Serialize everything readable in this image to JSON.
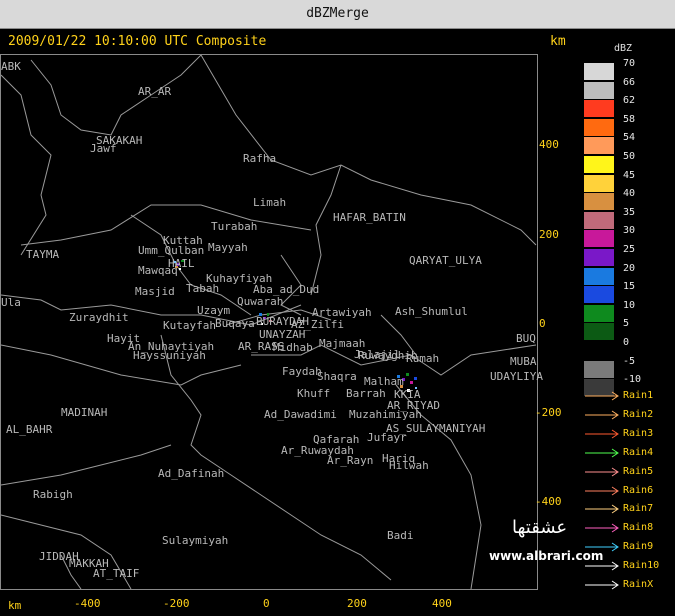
{
  "window": {
    "title": "dBZMerge"
  },
  "header": {
    "datetime": "2009/01/22 10:10:00 UTC Composite",
    "unit": "km"
  },
  "x_axis": {
    "unit": "km",
    "ticks": [
      "-400",
      "-200",
      "0",
      "200",
      "400"
    ]
  },
  "y_axis": {
    "ticks": [
      "400",
      "200",
      "0",
      "-200",
      "-400"
    ]
  },
  "places": [
    "ABK",
    "AR_AR",
    "SAKAKAH",
    "Jawf",
    "Rafha",
    "Limah",
    "HAFAR_BATIN",
    "Turabah",
    "Kuttah",
    "Mayyah",
    "Umm_Qulban",
    "TAYMA",
    "Mawqaq",
    "HAIL",
    "Kuhayfiyah",
    "QARYAT_ULYA",
    "Tabah",
    "Aba_ad_Dud",
    "Masjid",
    "Quwarah",
    "Ula",
    "Uzaym",
    "Artawiyah",
    "Ash_Shumlul",
    "Zuraydhit",
    "Kutayfah",
    "Buqaya",
    "BURAYDAH",
    "AZ_Zilfi",
    "BUQ",
    "Hayit",
    "UNAYZAH",
    "An_Nuhaytiyah",
    "AR_RASS",
    "Midhab",
    "Majmaah",
    "Hayssuniyah",
    "Jalajil",
    "Ruwayghib",
    "Rumah",
    "MUBA",
    "UDAYLIYA",
    "Faydah",
    "Shaqra",
    "Malham",
    "Khuff",
    "Barrah",
    "KKIA",
    "AR_RIYAD",
    "MADINAH",
    "Ad_Dawadimi",
    "Muzahimiyah",
    "AL_BAHR",
    "AS_SULAYMANIYAH",
    "Qafarah",
    "Jufayr",
    "Ar_Ruwaydah",
    "Ar_Rayn",
    "Hariq",
    "Hilwah",
    "Ad_Dafinah",
    "Rabigh",
    "Sulaymiyah",
    "Badi",
    "JIDDAH",
    "MAKKAH",
    "AT_TAIF"
  ],
  "legend": {
    "title": "dBZ",
    "colors": [
      "#d7d7d7",
      "#bdbdbd",
      "#ff3b1f",
      "#ff6a10",
      "#ff9a5a",
      "#fff51a",
      "#ffd23a",
      "#d89040",
      "#c06a7a",
      "#c8189a",
      "#7a18c8",
      "#1a7ae0",
      "#1a4ae0",
      "#0e8a1e",
      "#0c5a14",
      "#000000",
      "#7a7a7a",
      "#3a3a3a"
    ],
    "labels": [
      "70",
      "66",
      "62",
      "58",
      "54",
      "50",
      "45",
      "40",
      "35",
      "30",
      "25",
      "20",
      "15",
      "10",
      "5",
      "0",
      "-5",
      "-10"
    ]
  },
  "rain_legend": {
    "colors": [
      "#ffb060",
      "#ffb060",
      "#ff5a30",
      "#50ff50",
      "#ff9090",
      "#ff8060",
      "#ffd080",
      "#ff60c0",
      "#40d0ff",
      "#ffffff",
      "#ffffff"
    ],
    "labels": [
      "Rain1",
      "Rain2",
      "Rain3",
      "Rain4",
      "Rain5",
      "Rain6",
      "Rain7",
      "Rain8",
      "Rain9",
      "Rain10",
      "RainX"
    ]
  },
  "watermark": {
    "arabic": "عشقتها",
    "site": "www.albrari.com"
  }
}
